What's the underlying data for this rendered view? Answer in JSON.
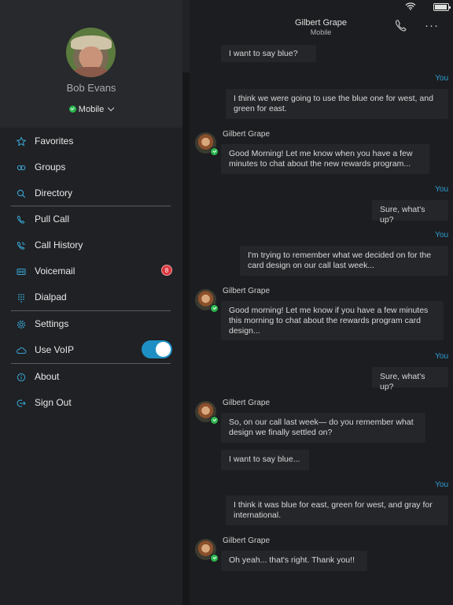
{
  "profile": {
    "name": "Bob Evans",
    "presence": "Mobile"
  },
  "menu": {
    "items": [
      {
        "label": "Favorites",
        "icon": "star-icon"
      },
      {
        "label": "Groups",
        "icon": "groups-icon"
      },
      {
        "label": "Directory",
        "icon": "search-icon"
      },
      {
        "label": "Pull Call",
        "icon": "pull-call-icon"
      },
      {
        "label": "Call History",
        "icon": "call-history-icon"
      },
      {
        "label": "Voicemail",
        "icon": "voicemail-icon",
        "badge": "8"
      },
      {
        "label": "Dialpad",
        "icon": "dialpad-icon"
      },
      {
        "label": "Settings",
        "icon": "gear-icon"
      },
      {
        "label": "Use VoIP",
        "icon": "cloud-icon",
        "toggle": true
      },
      {
        "label": "About",
        "icon": "info-icon"
      },
      {
        "label": "Sign Out",
        "icon": "sign-out-icon"
      }
    ]
  },
  "chat_header": {
    "name": "Gilbert Grape",
    "subtitle": "Mobile"
  },
  "accent_color": "#2d9fd4",
  "messages": {
    "m0": "I want to say blue?",
    "you1": "You",
    "m1": "I think we were going to use the blue one for west, and green for east.",
    "sender2": "Gilbert Grape",
    "m2": "Good Morning! Let me know when you have a few minutes to chat about the new rewards program...",
    "you3": "You",
    "m3": "Sure, what's up?",
    "you4": "You",
    "m4": "I'm trying to remember what we decided on for the card design on our call last week...",
    "sender5": "Gilbert Grape",
    "m5": "Good morning! Let me know if you have a few minutes this morning to chat about the rewards program card design...",
    "you6": "You",
    "m6": "Sure, what's up?",
    "sender7": "Gilbert Grape",
    "m7": "So, on our call last week— do you remember what design we finally settled on?",
    "m8": "I want to say blue...",
    "you9": "You",
    "m9": "I think it was blue for east, green for west, and gray for international.",
    "sender10": "Gilbert Grape",
    "m10": "Oh yeah... that's right. Thank you!!"
  }
}
